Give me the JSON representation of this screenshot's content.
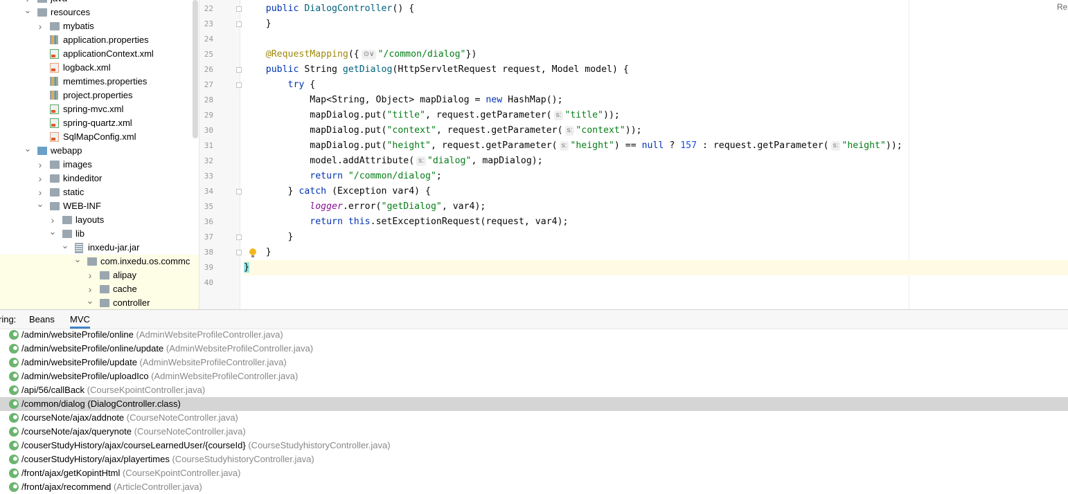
{
  "project_tree": {
    "items": [
      {
        "label": "java",
        "indent": 1,
        "icon": "source-folder-icon",
        "expand": "collapsed",
        "highlight": false
      },
      {
        "label": "resources",
        "indent": 1,
        "icon": "resources-folder-icon",
        "expand": "expanded",
        "highlight": false
      },
      {
        "label": "mybatis",
        "indent": 2,
        "icon": "folder-icon",
        "expand": "collapsed",
        "highlight": false
      },
      {
        "label": "application.properties",
        "indent": 2,
        "icon": "properties-file-icon",
        "expand": "none",
        "highlight": false
      },
      {
        "label": "applicationContext.xml",
        "indent": 2,
        "icon": "spring-xml-file-icon",
        "expand": "none",
        "highlight": false
      },
      {
        "label": "logback.xml",
        "indent": 2,
        "icon": "xml-file-icon",
        "expand": "none",
        "highlight": false
      },
      {
        "label": "memtimes.properties",
        "indent": 2,
        "icon": "properties-file-icon",
        "expand": "none",
        "highlight": false
      },
      {
        "label": "project.properties",
        "indent": 2,
        "icon": "properties-file-icon",
        "expand": "none",
        "highlight": false
      },
      {
        "label": "spring-mvc.xml",
        "indent": 2,
        "icon": "spring-xml-file-icon",
        "expand": "none",
        "highlight": false
      },
      {
        "label": "spring-quartz.xml",
        "indent": 2,
        "icon": "spring-xml-file-icon",
        "expand": "none",
        "highlight": false
      },
      {
        "label": "SqlMapConfig.xml",
        "indent": 2,
        "icon": "xml-file-icon",
        "expand": "none",
        "highlight": false
      },
      {
        "label": "webapp",
        "indent": 1,
        "icon": "web-folder-icon",
        "expand": "expanded",
        "highlight": false
      },
      {
        "label": "images",
        "indent": 2,
        "icon": "folder-icon",
        "expand": "collapsed",
        "highlight": false
      },
      {
        "label": "kindeditor",
        "indent": 2,
        "icon": "folder-icon",
        "expand": "collapsed",
        "highlight": false
      },
      {
        "label": "static",
        "indent": 2,
        "icon": "folder-icon",
        "expand": "collapsed",
        "highlight": false
      },
      {
        "label": "WEB-INF",
        "indent": 2,
        "icon": "folder-icon",
        "expand": "expanded",
        "highlight": false
      },
      {
        "label": "layouts",
        "indent": 3,
        "icon": "folder-icon",
        "expand": "collapsed",
        "highlight": false
      },
      {
        "label": "lib",
        "indent": 3,
        "icon": "folder-icon",
        "expand": "expanded",
        "highlight": false
      },
      {
        "label": "inxedu-jar.jar",
        "indent": 4,
        "icon": "jar-icon",
        "expand": "expanded",
        "highlight": false
      },
      {
        "label": "com.inxedu.os.commc",
        "indent": 5,
        "icon": "package-icon",
        "expand": "expanded",
        "highlight": true
      },
      {
        "label": "alipay",
        "indent": 6,
        "icon": "package-icon",
        "expand": "collapsed",
        "highlight": true
      },
      {
        "label": "cache",
        "indent": 6,
        "icon": "package-icon",
        "expand": "collapsed",
        "highlight": true
      },
      {
        "label": "controller",
        "indent": 6,
        "icon": "package-icon",
        "expand": "expanded",
        "highlight": true
      }
    ]
  },
  "editor": {
    "reader_mode_label": "Re",
    "current_line": 39,
    "lines": [
      {
        "num": "22",
        "fold": true,
        "tokens": [
          [
            "sp",
            "    "
          ],
          [
            "kw",
            "public "
          ],
          [
            "fn",
            "DialogController"
          ],
          [
            "t",
            "() {"
          ]
        ]
      },
      {
        "num": "23",
        "fold": true,
        "tokens": [
          [
            "sp",
            "    "
          ],
          [
            "t",
            "}"
          ]
        ]
      },
      {
        "num": "24",
        "fold": false,
        "tokens": []
      },
      {
        "num": "25",
        "fold": false,
        "tokens": [
          [
            "sp",
            "    "
          ],
          [
            "ann",
            "@RequestMapping"
          ],
          [
            "t",
            "({"
          ],
          [
            "hint",
            "⊙∨"
          ],
          [
            "str",
            "\"/common/dialog\""
          ],
          [
            "t",
            "})"
          ]
        ]
      },
      {
        "num": "26",
        "fold": true,
        "tokens": [
          [
            "sp",
            "    "
          ],
          [
            "kw",
            "public "
          ],
          [
            "t",
            "String "
          ],
          [
            "fn",
            "getDialog"
          ],
          [
            "t",
            "(HttpServletRequest request, Model model) {"
          ]
        ]
      },
      {
        "num": "27",
        "fold": true,
        "tokens": [
          [
            "sp",
            "        "
          ],
          [
            "kw",
            "try "
          ],
          [
            "t",
            "{"
          ]
        ]
      },
      {
        "num": "28",
        "fold": false,
        "tokens": [
          [
            "sp",
            "            "
          ],
          [
            "t",
            "Map<String, Object> mapDialog = "
          ],
          [
            "kw",
            "new "
          ],
          [
            "t",
            "HashMap();"
          ]
        ]
      },
      {
        "num": "29",
        "fold": false,
        "tokens": [
          [
            "sp",
            "            "
          ],
          [
            "t",
            "mapDialog.put("
          ],
          [
            "str",
            "\"title\""
          ],
          [
            "t",
            ", request.getParameter("
          ],
          [
            "hint",
            "s:"
          ],
          [
            "str",
            "\"title\""
          ],
          [
            "t",
            "));"
          ]
        ]
      },
      {
        "num": "30",
        "fold": false,
        "tokens": [
          [
            "sp",
            "            "
          ],
          [
            "t",
            "mapDialog.put("
          ],
          [
            "str",
            "\"context\""
          ],
          [
            "t",
            ", request.getParameter("
          ],
          [
            "hint",
            "s:"
          ],
          [
            "str",
            "\"context\""
          ],
          [
            "t",
            "));"
          ]
        ]
      },
      {
        "num": "31",
        "fold": false,
        "tokens": [
          [
            "sp",
            "            "
          ],
          [
            "t",
            "mapDialog.put("
          ],
          [
            "str",
            "\"height\""
          ],
          [
            "t",
            ", request.getParameter("
          ],
          [
            "hint",
            "s:"
          ],
          [
            "str",
            "\"height\""
          ],
          [
            "t",
            ") == "
          ],
          [
            "kw",
            "null"
          ],
          [
            "t",
            " ? "
          ],
          [
            "num",
            "157"
          ],
          [
            "t",
            " : request.getParameter("
          ],
          [
            "hint",
            "s:"
          ],
          [
            "str",
            "\"height\""
          ],
          [
            "t",
            "));"
          ]
        ]
      },
      {
        "num": "32",
        "fold": false,
        "tokens": [
          [
            "sp",
            "            "
          ],
          [
            "t",
            "model.addAttribute("
          ],
          [
            "hint",
            "s:"
          ],
          [
            "str",
            "\"dialog\""
          ],
          [
            "t",
            ", mapDialog);"
          ]
        ]
      },
      {
        "num": "33",
        "fold": false,
        "tokens": [
          [
            "sp",
            "            "
          ],
          [
            "kw",
            "return "
          ],
          [
            "str",
            "\"/common/dialog\""
          ],
          [
            "t",
            ";"
          ]
        ]
      },
      {
        "num": "34",
        "fold": true,
        "tokens": [
          [
            "sp",
            "        "
          ],
          [
            "t",
            "} "
          ],
          [
            "kw",
            "catch "
          ],
          [
            "t",
            "(Exception var4) {"
          ]
        ]
      },
      {
        "num": "35",
        "fold": false,
        "tokens": [
          [
            "sp",
            "            "
          ],
          [
            "fld",
            "logger"
          ],
          [
            "t",
            ".error("
          ],
          [
            "str",
            "\"getDialog\""
          ],
          [
            "t",
            ", var4);"
          ]
        ]
      },
      {
        "num": "36",
        "fold": false,
        "tokens": [
          [
            "sp",
            "            "
          ],
          [
            "kw",
            "return this"
          ],
          [
            "t",
            ".setExceptionRequest(request, var4);"
          ]
        ]
      },
      {
        "num": "37",
        "fold": true,
        "tokens": [
          [
            "sp",
            "        "
          ],
          [
            "t",
            "}"
          ]
        ]
      },
      {
        "num": "38",
        "fold": true,
        "tokens": [
          [
            "sp",
            "    "
          ],
          [
            "t",
            "}"
          ]
        ]
      },
      {
        "num": "39",
        "fold": false,
        "tokens": [
          [
            "brace",
            "}"
          ]
        ]
      },
      {
        "num": "40",
        "fold": false,
        "tokens": []
      }
    ]
  },
  "bottom_panel": {
    "header_prefix": "ring:",
    "tabs": [
      {
        "label": "Beans",
        "active": false
      },
      {
        "label": "MVC",
        "active": true
      }
    ],
    "mappings": [
      {
        "path": "/admin/websiteProfile/online",
        "controller": "(AdminWebsiteProfileController.java)",
        "selected": false
      },
      {
        "path": "/admin/websiteProfile/online/update",
        "controller": "(AdminWebsiteProfileController.java)",
        "selected": false
      },
      {
        "path": "/admin/websiteProfile/update",
        "controller": "(AdminWebsiteProfileController.java)",
        "selected": false
      },
      {
        "path": "/admin/websiteProfile/uploadIco",
        "controller": "(AdminWebsiteProfileController.java)",
        "selected": false
      },
      {
        "path": "/api/56/callBack",
        "controller": "(CourseKpointController.java)",
        "selected": false
      },
      {
        "path": "/common/dialog",
        "controller": "(DialogController.class)",
        "selected": true
      },
      {
        "path": "/courseNote/ajax/addnote",
        "controller": "(CourseNoteController.java)",
        "selected": false
      },
      {
        "path": "/courseNote/ajax/querynote",
        "controller": "(CourseNoteController.java)",
        "selected": false
      },
      {
        "path": "/couserStudyHistory/ajax/courseLearnedUser/{courseId}",
        "controller": "(CourseStudyhistoryController.java)",
        "selected": false
      },
      {
        "path": "/couserStudyHistory/ajax/playertimes",
        "controller": "(CourseStudyhistoryController.java)",
        "selected": false
      },
      {
        "path": "/front/ajax/getKopintHtml",
        "controller": "(CourseKpointController.java)",
        "selected": false
      },
      {
        "path": "/front/ajax/recommend",
        "controller": "(ArticleController.java)",
        "selected": false
      }
    ]
  }
}
